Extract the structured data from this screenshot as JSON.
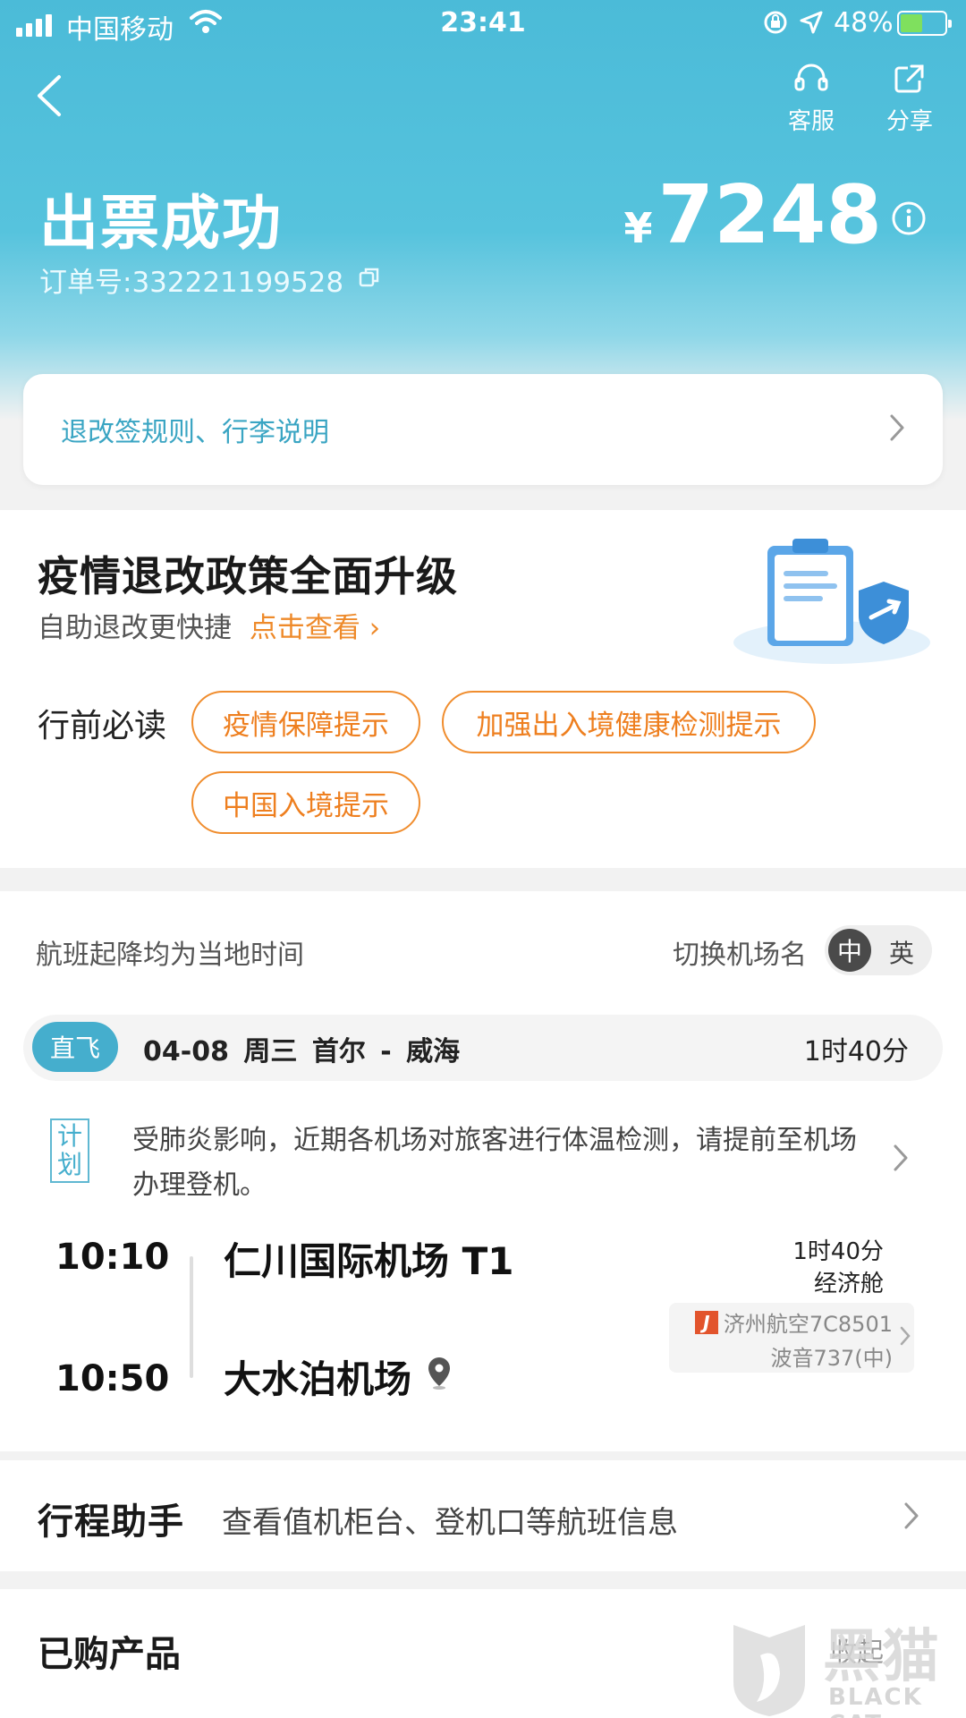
{
  "status_bar": {
    "carrier": "中国移动",
    "time": "23:41",
    "battery": "48%",
    "battery_level": 0.48,
    "icons": [
      "signal-icon",
      "wifi-icon",
      "rotation-lock-icon",
      "location-icon",
      "battery-charging-icon"
    ]
  },
  "header": {
    "back_icon": "back-chevron-icon",
    "service_label": "客服",
    "share_label": "分享",
    "title": "出票成功",
    "order_number": "订单号:332221199528",
    "currency": "¥",
    "price": "7248",
    "accent_color": "#4bbbd8"
  },
  "rules": {
    "label": "退改签规则、行李说明"
  },
  "covid": {
    "heading": "疫情退改政策全面升级",
    "subtitle": "自助退改更快捷",
    "link": "点击查看",
    "must_read": "行前必读",
    "pills": [
      "疫情保障提示",
      "加强出入境健康检测提示",
      "中国入境提示"
    ],
    "pill_color": "#f08d2e"
  },
  "flight": {
    "time_note": "航班起降均为当地时间",
    "switch_label": "切换机场名",
    "lang_on": "中",
    "lang_off": "英",
    "segment_tag": "直飞",
    "segment_route": "04-08 周三 首尔 - 威海",
    "segment_duration": "1时40分",
    "plan_tag": "计划",
    "plan_text": "受肺炎影响，近期各机场对旅客进行体温检测，请提前至机场办理登机。",
    "dep_time": "10:10",
    "arr_time": "10:50",
    "dep_airport": "仁川国际机场 T1",
    "arr_airport": "大水泊机场",
    "duration": "1时40分",
    "cabin": "经济舱",
    "airline": "济州航空7C8501",
    "aircraft": "波音737(中)"
  },
  "assistant": {
    "brand": "行程助手",
    "text": "查看值机柜台、登机口等航班信息"
  },
  "purchased": {
    "heading": "已购产品",
    "collapse": "收起"
  },
  "watermark": {
    "cn": "黑猫",
    "en": "BLACK CAT"
  }
}
